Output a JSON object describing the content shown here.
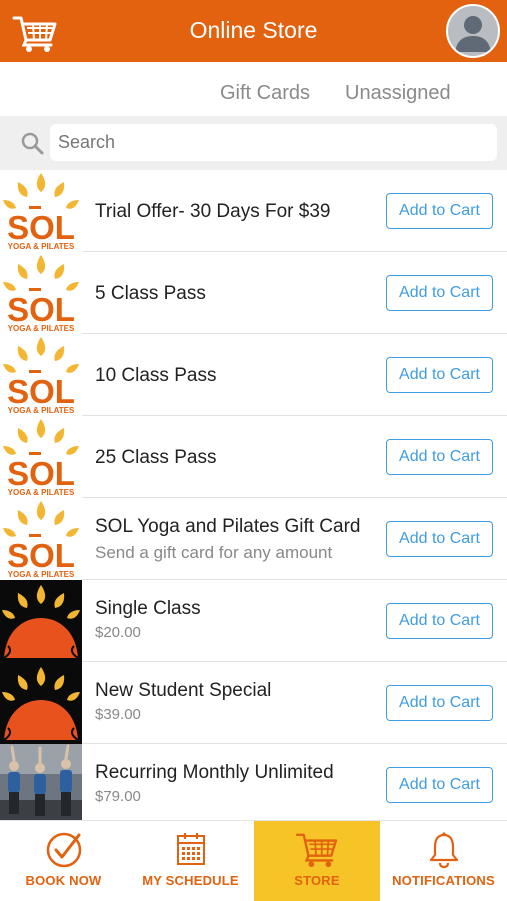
{
  "header": {
    "title": "Online Store",
    "cart_icon": "cart-icon",
    "avatar_icon": "user-avatar-icon"
  },
  "tabs": [
    {
      "label": "Gift Cards"
    },
    {
      "label": "Unassigned"
    }
  ],
  "search": {
    "placeholder": "Search"
  },
  "products": [
    {
      "name": "Trial Offer- 30 Days For $39",
      "sub": "",
      "image": "sol-logo",
      "button": "Add to Cart"
    },
    {
      "name": "5 Class Pass",
      "sub": "",
      "image": "sol-logo",
      "button": "Add to Cart"
    },
    {
      "name": "10 Class Pass",
      "sub": "",
      "image": "sol-logo",
      "button": "Add to Cart"
    },
    {
      "name": "25 Class Pass",
      "sub": "",
      "image": "sol-logo",
      "button": "Add to Cart"
    },
    {
      "name": "SOL Yoga and Pilates Gift Card",
      "sub": "Send a gift card for any amount",
      "image": "sol-logo",
      "button": "Add to Cart"
    },
    {
      "name": "Single Class",
      "sub": "$20.00",
      "image": "sunrise",
      "button": "Add to Cart"
    },
    {
      "name": "New Student Special",
      "sub": "$39.00",
      "image": "sunrise",
      "button": "Add to Cart"
    },
    {
      "name": "Recurring Monthly Unlimited",
      "sub": "$79.00",
      "image": "yoga-class-photo",
      "button": "Add to Cart"
    }
  ],
  "logo_text": {
    "brand": "SOL",
    "tagline": "YOGA & PILATES"
  },
  "bottom_nav": [
    {
      "label": "BOOK NOW",
      "icon": "check-circle-icon",
      "active": false
    },
    {
      "label": "MY SCHEDULE",
      "icon": "calendar-icon",
      "active": false
    },
    {
      "label": "STORE",
      "icon": "cart-icon",
      "active": true
    },
    {
      "label": "NOTIFICATIONS",
      "icon": "bell-icon",
      "active": false
    }
  ],
  "colors": {
    "brand_orange": "#e2620f",
    "active_tab_yellow": "#f7c428",
    "button_blue": "#3f9de0"
  }
}
